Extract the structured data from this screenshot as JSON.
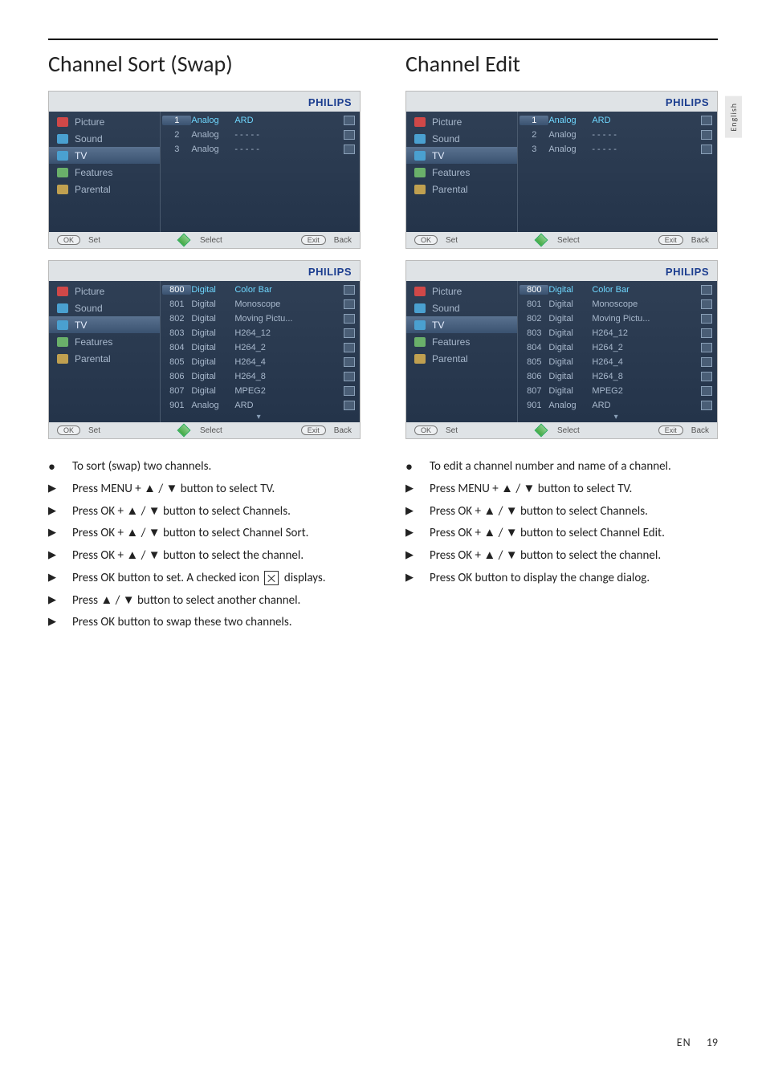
{
  "lang_tab": "English",
  "page_lang": "EN",
  "page_number": "19",
  "brand": "PHILIPS",
  "footer": {
    "ok": "OK",
    "set": "Set",
    "select": "Select",
    "exit": "Exit",
    "back": "Back"
  },
  "menu_items": [
    {
      "label": "Picture",
      "color": "#d04848"
    },
    {
      "label": "Sound",
      "color": "#4aa0d0"
    },
    {
      "label": "TV",
      "color": "#4aa0d0"
    },
    {
      "label": "Features",
      "color": "#6ab06a"
    },
    {
      "label": "Parental",
      "color": "#c0a050"
    }
  ],
  "left": {
    "title": "Channel Sort (Swap)",
    "shot1_channels": [
      {
        "num": "1",
        "type": "Analog",
        "name": "ARD",
        "selected": true
      },
      {
        "num": "2",
        "type": "Analog",
        "name": "- - - - -",
        "selected": false
      },
      {
        "num": "3",
        "type": "Analog",
        "name": "- - - - -",
        "selected": false
      }
    ],
    "shot2_channels": [
      {
        "num": "800",
        "type": "Digital",
        "name": "Color Bar",
        "selected": true
      },
      {
        "num": "801",
        "type": "Digital",
        "name": "Monoscope",
        "selected": false
      },
      {
        "num": "802",
        "type": "Digital",
        "name": "Moving Pictu...",
        "selected": false
      },
      {
        "num": "803",
        "type": "Digital",
        "name": "H264_12",
        "selected": false
      },
      {
        "num": "804",
        "type": "Digital",
        "name": "H264_2",
        "selected": false
      },
      {
        "num": "805",
        "type": "Digital",
        "name": "H264_4",
        "selected": false
      },
      {
        "num": "806",
        "type": "Digital",
        "name": "H264_8",
        "selected": false
      },
      {
        "num": "807",
        "type": "Digital",
        "name": "MPEG2",
        "selected": false
      },
      {
        "num": "901",
        "type": "Analog",
        "name": "ARD",
        "selected": false
      }
    ],
    "instructions": [
      {
        "kind": "dot",
        "text": "To sort (swap) two channels."
      },
      {
        "kind": "play",
        "text": "Press MENU + ▲ / ▼ button to select TV."
      },
      {
        "kind": "play",
        "text": "Press OK + ▲ / ▼ button to select Channels."
      },
      {
        "kind": "play",
        "text": "Press OK + ▲ / ▼ button to select Channel Sort."
      },
      {
        "kind": "play",
        "text": "Press OK + ▲ / ▼ button to select the channel."
      },
      {
        "kind": "play",
        "text": "Press OK button to set. A checked icon",
        "has_checked_icon": true,
        "text_after": " displays."
      },
      {
        "kind": "play",
        "text": "Press ▲ / ▼ button to select another channel."
      },
      {
        "kind": "play",
        "text": "Press OK button to swap these two channels."
      }
    ]
  },
  "right": {
    "title": "Channel Edit",
    "shot1_channels": [
      {
        "num": "1",
        "type": "Analog",
        "name": "ARD",
        "selected": true
      },
      {
        "num": "2",
        "type": "Analog",
        "name": "- - - - -",
        "selected": false
      },
      {
        "num": "3",
        "type": "Analog",
        "name": "- - - - -",
        "selected": false
      }
    ],
    "shot2_channels": [
      {
        "num": "800",
        "type": "Digital",
        "name": "Color Bar",
        "selected": true
      },
      {
        "num": "801",
        "type": "Digital",
        "name": "Monoscope",
        "selected": false
      },
      {
        "num": "802",
        "type": "Digital",
        "name": "Moving Pictu...",
        "selected": false
      },
      {
        "num": "803",
        "type": "Digital",
        "name": "H264_12",
        "selected": false
      },
      {
        "num": "804",
        "type": "Digital",
        "name": "H264_2",
        "selected": false
      },
      {
        "num": "805",
        "type": "Digital",
        "name": "H264_4",
        "selected": false
      },
      {
        "num": "806",
        "type": "Digital",
        "name": "H264_8",
        "selected": false
      },
      {
        "num": "807",
        "type": "Digital",
        "name": "MPEG2",
        "selected": false
      },
      {
        "num": "901",
        "type": "Analog",
        "name": "ARD",
        "selected": false
      }
    ],
    "instructions": [
      {
        "kind": "dot",
        "text": "To edit a channel number and name of a channel."
      },
      {
        "kind": "play",
        "text": "Press MENU + ▲ / ▼ button to select TV."
      },
      {
        "kind": "play",
        "text": "Press OK + ▲ / ▼ button to select Channels."
      },
      {
        "kind": "play",
        "text": "Press OK + ▲ / ▼ button to select Channel Edit."
      },
      {
        "kind": "play",
        "text": "Press OK + ▲ / ▼ button to select the channel."
      },
      {
        "kind": "play",
        "text": "Press OK button to display the change dialog."
      }
    ]
  }
}
